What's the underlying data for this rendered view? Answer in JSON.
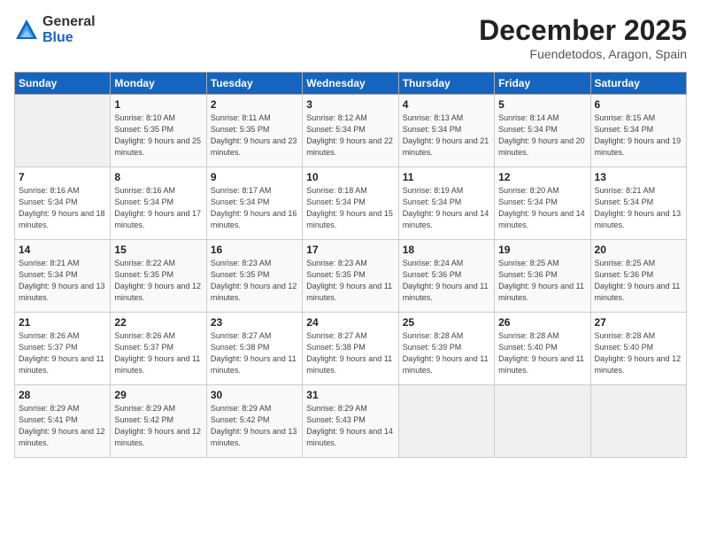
{
  "header": {
    "logo_general": "General",
    "logo_blue": "Blue",
    "month": "December 2025",
    "location": "Fuendetodos, Aragon, Spain"
  },
  "weekdays": [
    "Sunday",
    "Monday",
    "Tuesday",
    "Wednesday",
    "Thursday",
    "Friday",
    "Saturday"
  ],
  "weeks": [
    [
      {
        "day": "",
        "info": ""
      },
      {
        "day": "1",
        "info": "Sunrise: 8:10 AM\nSunset: 5:35 PM\nDaylight: 9 hours\nand 25 minutes."
      },
      {
        "day": "2",
        "info": "Sunrise: 8:11 AM\nSunset: 5:35 PM\nDaylight: 9 hours\nand 23 minutes."
      },
      {
        "day": "3",
        "info": "Sunrise: 8:12 AM\nSunset: 5:34 PM\nDaylight: 9 hours\nand 22 minutes."
      },
      {
        "day": "4",
        "info": "Sunrise: 8:13 AM\nSunset: 5:34 PM\nDaylight: 9 hours\nand 21 minutes."
      },
      {
        "day": "5",
        "info": "Sunrise: 8:14 AM\nSunset: 5:34 PM\nDaylight: 9 hours\nand 20 minutes."
      },
      {
        "day": "6",
        "info": "Sunrise: 8:15 AM\nSunset: 5:34 PM\nDaylight: 9 hours\nand 19 minutes."
      }
    ],
    [
      {
        "day": "7",
        "info": "Sunrise: 8:16 AM\nSunset: 5:34 PM\nDaylight: 9 hours\nand 18 minutes."
      },
      {
        "day": "8",
        "info": "Sunrise: 8:16 AM\nSunset: 5:34 PM\nDaylight: 9 hours\nand 17 minutes."
      },
      {
        "day": "9",
        "info": "Sunrise: 8:17 AM\nSunset: 5:34 PM\nDaylight: 9 hours\nand 16 minutes."
      },
      {
        "day": "10",
        "info": "Sunrise: 8:18 AM\nSunset: 5:34 PM\nDaylight: 9 hours\nand 15 minutes."
      },
      {
        "day": "11",
        "info": "Sunrise: 8:19 AM\nSunset: 5:34 PM\nDaylight: 9 hours\nand 14 minutes."
      },
      {
        "day": "12",
        "info": "Sunrise: 8:20 AM\nSunset: 5:34 PM\nDaylight: 9 hours\nand 14 minutes."
      },
      {
        "day": "13",
        "info": "Sunrise: 8:21 AM\nSunset: 5:34 PM\nDaylight: 9 hours\nand 13 minutes."
      }
    ],
    [
      {
        "day": "14",
        "info": "Sunrise: 8:21 AM\nSunset: 5:34 PM\nDaylight: 9 hours\nand 13 minutes."
      },
      {
        "day": "15",
        "info": "Sunrise: 8:22 AM\nSunset: 5:35 PM\nDaylight: 9 hours\nand 12 minutes."
      },
      {
        "day": "16",
        "info": "Sunrise: 8:23 AM\nSunset: 5:35 PM\nDaylight: 9 hours\nand 12 minutes."
      },
      {
        "day": "17",
        "info": "Sunrise: 8:23 AM\nSunset: 5:35 PM\nDaylight: 9 hours\nand 11 minutes."
      },
      {
        "day": "18",
        "info": "Sunrise: 8:24 AM\nSunset: 5:36 PM\nDaylight: 9 hours\nand 11 minutes."
      },
      {
        "day": "19",
        "info": "Sunrise: 8:25 AM\nSunset: 5:36 PM\nDaylight: 9 hours\nand 11 minutes."
      },
      {
        "day": "20",
        "info": "Sunrise: 8:25 AM\nSunset: 5:36 PM\nDaylight: 9 hours\nand 11 minutes."
      }
    ],
    [
      {
        "day": "21",
        "info": "Sunrise: 8:26 AM\nSunset: 5:37 PM\nDaylight: 9 hours\nand 11 minutes."
      },
      {
        "day": "22",
        "info": "Sunrise: 8:26 AM\nSunset: 5:37 PM\nDaylight: 9 hours\nand 11 minutes."
      },
      {
        "day": "23",
        "info": "Sunrise: 8:27 AM\nSunset: 5:38 PM\nDaylight: 9 hours\nand 11 minutes."
      },
      {
        "day": "24",
        "info": "Sunrise: 8:27 AM\nSunset: 5:38 PM\nDaylight: 9 hours\nand 11 minutes."
      },
      {
        "day": "25",
        "info": "Sunrise: 8:28 AM\nSunset: 5:39 PM\nDaylight: 9 hours\nand 11 minutes."
      },
      {
        "day": "26",
        "info": "Sunrise: 8:28 AM\nSunset: 5:40 PM\nDaylight: 9 hours\nand 11 minutes."
      },
      {
        "day": "27",
        "info": "Sunrise: 8:28 AM\nSunset: 5:40 PM\nDaylight: 9 hours\nand 12 minutes."
      }
    ],
    [
      {
        "day": "28",
        "info": "Sunrise: 8:29 AM\nSunset: 5:41 PM\nDaylight: 9 hours\nand 12 minutes."
      },
      {
        "day": "29",
        "info": "Sunrise: 8:29 AM\nSunset: 5:42 PM\nDaylight: 9 hours\nand 12 minutes."
      },
      {
        "day": "30",
        "info": "Sunrise: 8:29 AM\nSunset: 5:42 PM\nDaylight: 9 hours\nand 13 minutes."
      },
      {
        "day": "31",
        "info": "Sunrise: 8:29 AM\nSunset: 5:43 PM\nDaylight: 9 hours\nand 14 minutes."
      },
      {
        "day": "",
        "info": ""
      },
      {
        "day": "",
        "info": ""
      },
      {
        "day": "",
        "info": ""
      }
    ]
  ]
}
